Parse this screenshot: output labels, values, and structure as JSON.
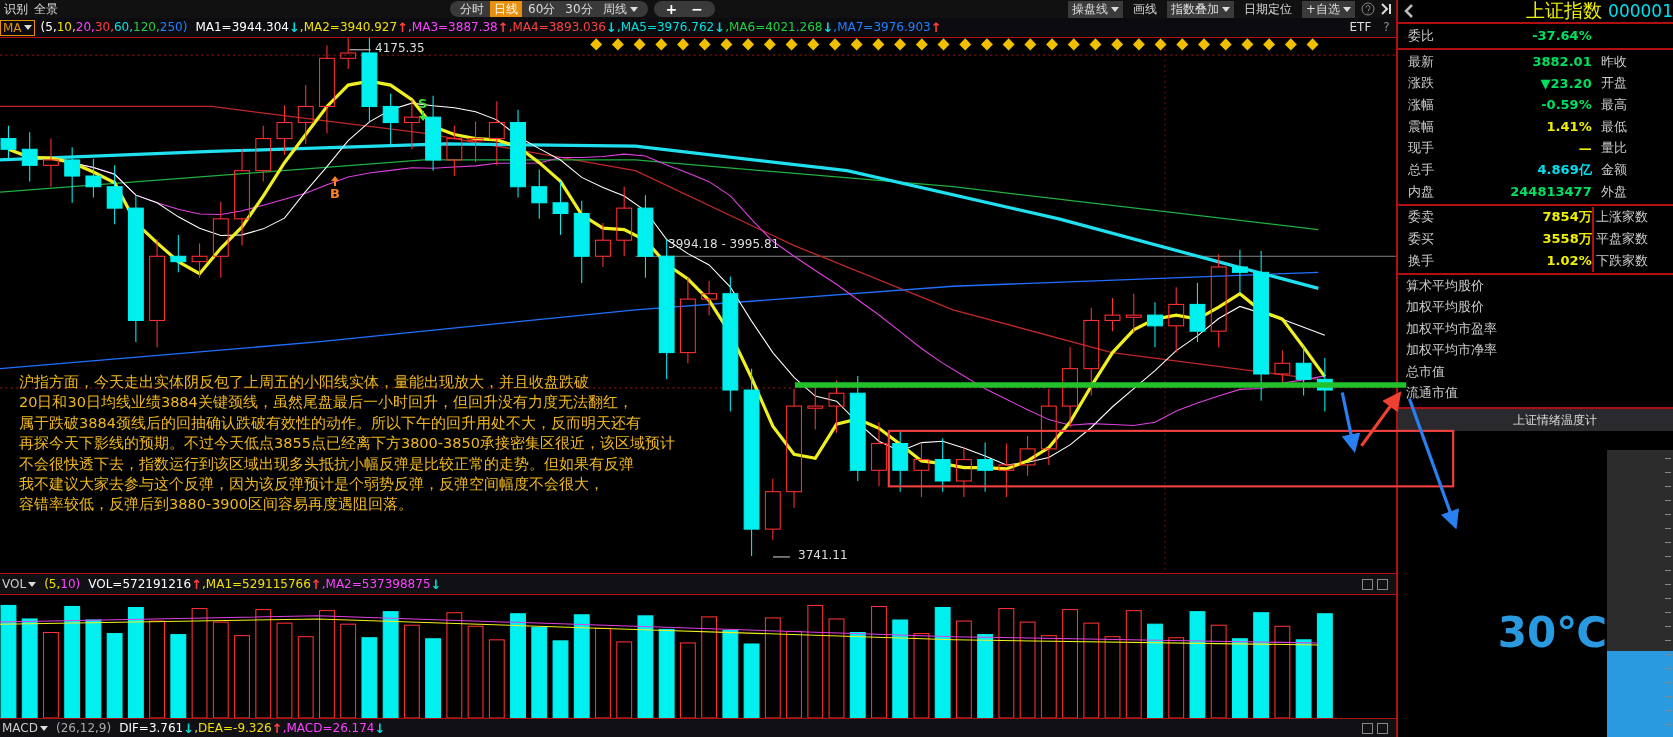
{
  "toolbar": {
    "left": [
      "识别",
      "全景"
    ],
    "periods": [
      {
        "label": "分时",
        "selected": false,
        "dropdown": false
      },
      {
        "label": "日线",
        "selected": true,
        "dropdown": false
      },
      {
        "label": "60分",
        "selected": false,
        "dropdown": false
      },
      {
        "label": "30分",
        "selected": false,
        "dropdown": false
      },
      {
        "label": "周线",
        "selected": false,
        "dropdown": true
      }
    ],
    "zoom": [
      "+",
      "−"
    ],
    "tools": [
      {
        "label": "操盘线",
        "dropdown": true,
        "boxed": true
      },
      {
        "label": "画线",
        "dropdown": false,
        "boxed": false
      },
      {
        "label": "指数叠加",
        "dropdown": true,
        "boxed": true
      },
      {
        "label": "日期定位",
        "dropdown": false,
        "boxed": false
      },
      {
        "label": "+自选",
        "dropdown": true,
        "boxed": true
      }
    ]
  },
  "ma_legend": {
    "indicator": "MA",
    "params": [
      {
        "text": "(5,",
        "color": "#ffffff"
      },
      {
        "text": "10,",
        "color": "#f0e000"
      },
      {
        "text": "20,",
        "color": "#ff40ff"
      },
      {
        "text": "30,",
        "color": "#ff4040"
      },
      {
        "text": "60,",
        "color": "#00e0e0"
      },
      {
        "text": "120,",
        "color": "#20d040"
      },
      {
        "text": "250)",
        "color": "#2080ff"
      }
    ],
    "values": [
      {
        "text": "MA1=3944.304",
        "color": "#ffffff"
      },
      {
        "text": "↓",
        "color": "#00e0e0"
      },
      {
        "text": ",MA2=3940.927",
        "color": "#f0e000"
      },
      {
        "text": "↑",
        "color": "#ff4040"
      },
      {
        "text": ",MA3=3887.38",
        "color": "#ff40ff"
      },
      {
        "text": "↑",
        "color": "#ff4040"
      },
      {
        "text": ",MA4=3893.036",
        "color": "#ff4040"
      },
      {
        "text": "↓",
        "color": "#00e0e0"
      },
      {
        "text": ",MA5=3976.762",
        "color": "#00e0e0"
      },
      {
        "text": "↓",
        "color": "#00e0e0"
      },
      {
        "text": ",MA6=4021.268",
        "color": "#20d040"
      },
      {
        "text": "↓",
        "color": "#00e0e0"
      },
      {
        "text": ",MA7=3976.903",
        "color": "#2080ff"
      },
      {
        "text": "↑",
        "color": "#ff4040"
      }
    ],
    "etf": "ETF",
    "help": "?"
  },
  "chart": {
    "high_label": "4175.35",
    "low_label": "3741.11",
    "range_label": "3994.18 - 3995.81",
    "signals": [
      {
        "kind": "sell",
        "text": "S"
      },
      {
        "kind": "buy",
        "text": "B"
      }
    ],
    "note_lines": [
      "沪指方面，今天走出实体阴反包了上周五的小阳线实体，量能出现放大，并且收盘跌破",
      "20日和30日均线业绩3884关键颈线，虽然尾盘最后一小时回升，但回升没有力度无法翻红，",
      "属于跌破3884颈线后的回抽确认跌破有效性的动作。所以下午的回升用处不大，反而明天还有",
      "再探今天下影线的预期。不过今天低点3855点已经离下方3800-3850承接密集区很近，该区域预计",
      "不会很快透下去，指数运行到该区域出现多头抵抗小幅反弹是比较正常的走势。但如果有反弹",
      "我不建议大家去参与这个反弹，因为该反弹预计是个弱势反弹，反弹空间幅度不会很大，",
      "容错率较低，反弹后到3880-3900区间容易再度遇阻回落。"
    ]
  },
  "volume": {
    "indicator": "VOL",
    "params": [
      {
        "text": "(5,",
        "color": "#f0e000"
      },
      {
        "text": "10)",
        "color": "#ff40ff"
      }
    ],
    "values": [
      {
        "text": "VOL=572191216",
        "color": "#ffffff"
      },
      {
        "text": "↑",
        "color": "#ff4040"
      },
      {
        "text": ",MA1=529115766",
        "color": "#f0e000"
      },
      {
        "text": "↑",
        "color": "#ff4040"
      },
      {
        "text": ",MA2=537398875",
        "color": "#ff40ff"
      },
      {
        "text": "↓",
        "color": "#00e0e0"
      }
    ]
  },
  "macd": {
    "indicator": "MACD",
    "params": [
      {
        "text": "(26,12,9)",
        "color": "#aaaaaa"
      }
    ],
    "values": [
      {
        "text": "DIF=3.761",
        "color": "#ffffff"
      },
      {
        "text": "↓",
        "color": "#00e0e0"
      },
      {
        "text": ",DEA=-9.326",
        "color": "#f0e000"
      },
      {
        "text": "↑",
        "color": "#ff4040"
      },
      {
        "text": ",MACD=26.174",
        "color": "#ff40ff"
      },
      {
        "text": "↓",
        "color": "#00e0e0"
      }
    ]
  },
  "quote": {
    "title": "上证指数",
    "code": "000001",
    "ratio": {
      "label": "委比",
      "value": "-37.64%",
      "color": "#00e060"
    },
    "rows": [
      {
        "label": "最新",
        "value": "3882.01",
        "color": "#00e060",
        "right_label": "昨收"
      },
      {
        "label": "涨跌",
        "value": "▼23.20",
        "color": "#00e060",
        "right_label": "开盘"
      },
      {
        "label": "涨幅",
        "value": "-0.59%",
        "color": "#00e060",
        "right_label": "最高"
      },
      {
        "label": "震幅",
        "value": "1.41%",
        "color": "#f0f000",
        "right_label": "最低"
      },
      {
        "label": "现手",
        "value": "—",
        "color": "#f0f000",
        "right_label": "量比"
      },
      {
        "label": "总手",
        "value": "4.869亿",
        "color": "#00e0f0",
        "right_label": "金额"
      },
      {
        "label": "内盘",
        "value": "244813477",
        "color": "#00e060",
        "right_label": "外盘"
      }
    ],
    "orders": [
      {
        "label": "委卖",
        "value": "7854万",
        "color": "#f0f000",
        "right_label": "上涨家数"
      },
      {
        "label": "委买",
        "value": "3558万",
        "color": "#f0f000",
        "right_label": "平盘家数"
      },
      {
        "label": "换手",
        "value": "1.02%",
        "color": "#f0f000",
        "right_label": "下跌家数"
      }
    ],
    "stats": [
      "算术平均股价",
      "加权平均股价",
      "加权平均市盈率",
      "加权平均市净率",
      "总市值",
      "流通市值"
    ]
  },
  "gauge": {
    "title": "上证情绪温度计",
    "reading": "30℃",
    "level": 0.3
  }
}
